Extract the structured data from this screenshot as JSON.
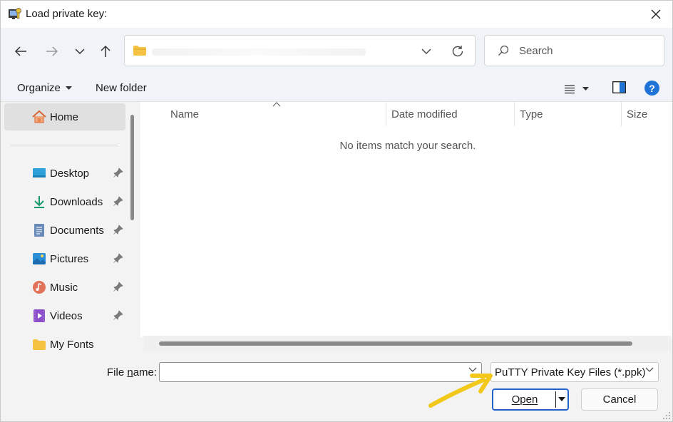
{
  "window": {
    "title": "Load private key:"
  },
  "search": {
    "placeholder": "Search"
  },
  "toolbar": {
    "organize_label": "Organize",
    "new_folder_label": "New folder"
  },
  "sidebar": {
    "home_label": "Home",
    "items": [
      {
        "label": "Desktop",
        "icon": "desktop-icon"
      },
      {
        "label": "Downloads",
        "icon": "download-icon"
      },
      {
        "label": "Documents",
        "icon": "document-icon"
      },
      {
        "label": "Pictures",
        "icon": "pictures-icon"
      },
      {
        "label": "Music",
        "icon": "music-icon"
      },
      {
        "label": "Videos",
        "icon": "video-icon"
      },
      {
        "label": "My Fonts",
        "icon": "folder-icon"
      }
    ]
  },
  "file_list": {
    "columns": [
      "Name",
      "Date modified",
      "Type",
      "Size"
    ],
    "empty_message": "No items match your search."
  },
  "bottom": {
    "file_name_label_prefix": "File ",
    "file_name_label_access": "n",
    "file_name_label_suffix": "ame:",
    "file_name_value": "",
    "file_type_value": "PuTTY Private Key Files (*.ppk)",
    "open_label": "Open",
    "cancel_label": "Cancel"
  },
  "colors": {
    "accent": "#1f62c9",
    "annotation_arrow": "#f2c81b",
    "folder": "#f5c242"
  }
}
